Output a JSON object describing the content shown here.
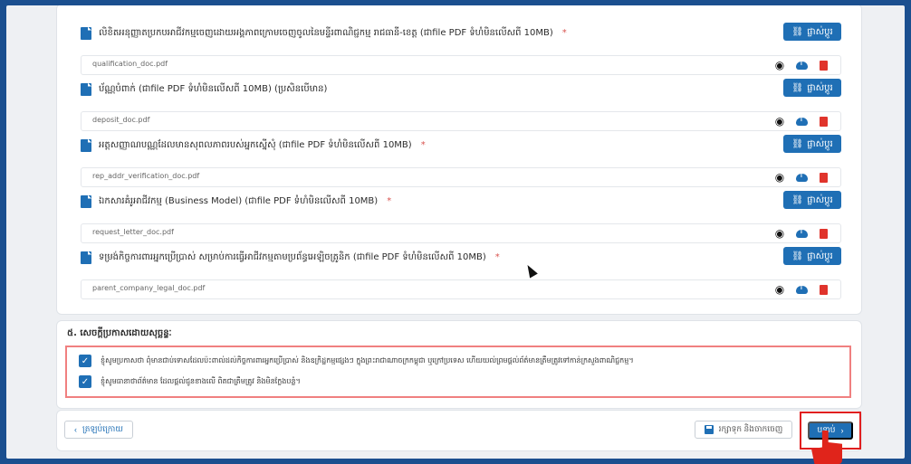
{
  "documents": [
    {
      "label": "លិខិតអនុញ្ញាតប្រកបអាជីវកម្មចេញដោយអង្គភាពក្រោមចេញចូលនៃមន្ទីរពាណិជ្ជកម្ម រាជធានី-ខេត្ត (ជាfile PDF ទំហំមិនលើសពី 10MB)",
      "required": true,
      "file": "qualification_doc.pdf",
      "change_label": "ផ្លាស់ប្តូរ"
    },
    {
      "label": "ប័ណ្ណបំពាក់ (ជាfile PDF ទំហំមិនលើសពី 10MB) (ប្រសិនបើមាន)",
      "required": false,
      "file": "deposit_doc.pdf",
      "change_label": "ផ្លាស់ប្តូរ"
    },
    {
      "label": "អត្តសញ្ញាណបណ្ណដែលមានសុពលភាពរបស់អ្នកស្នើសុំ (ជាfile PDF ទំហំមិនលើសពី 10MB)",
      "required": true,
      "file": "rep_addr_verification_doc.pdf",
      "change_label": "ផ្លាស់ប្តូរ"
    },
    {
      "label": "ឯកសារគំរូអាជីវកម្ម (Business Model) (ជាfile PDF ទំហំមិនលើសពី 10MB)",
      "required": true,
      "file": "request_letter_doc.pdf",
      "change_label": "ផ្លាស់ប្តូរ"
    },
    {
      "label": "ទម្រង់កិច្ចការពារអ្នកប្រើប្រាស់ សម្រាប់ការធ្វើអាជីវកម្មតាមប្រព័ន្ធអេឡិចត្រូនិក (ជាfile PDF ទំហំមិនលើសពី 10MB)",
      "required": true,
      "file": "parent_company_legal_doc.pdf",
      "change_label": "ផ្លាស់ប្តូរ"
    }
  ],
  "required_mark": "*",
  "declaration": {
    "title": "៥. សេចក្តីប្រកាសដោយសុច្ឆន្ទៈ",
    "items": [
      "ខ្ញុំសូមប្រកាសថា ពុំមានជាប់ទោសដែលប៉ះពាល់ដល់កិច្ចការពារអ្នកប្រើប្រាស់ និងឧក្រិដ្ឋកម្មផ្សេងៗ ក្នុងព្រះរាជាណាចក្រកម្ពុជា ឬក្រៅប្រទេស ហើយយល់ព្រមផ្តល់ព័ត៌មានត្រឹមត្រូវទៅកាន់ក្រសួងពាណិជ្ជកម្ម។",
      "ខ្ញុំសូមធានាថាព័ត៌មាន ដែលផ្តល់ជូនខាងលើ ពិតជាត្រឹមត្រូវ និងមិនក្លែងបន្លំ។"
    ]
  },
  "footer": {
    "back_label": "ត្រឡប់ក្រោយ",
    "save_label": "រក្សាទុក និងចាកចេញ",
    "next_label": "បន្ទាប់"
  },
  "colors": {
    "accent": "#1f6fb5",
    "danger": "#e0342c",
    "highlight": "#f08080"
  }
}
